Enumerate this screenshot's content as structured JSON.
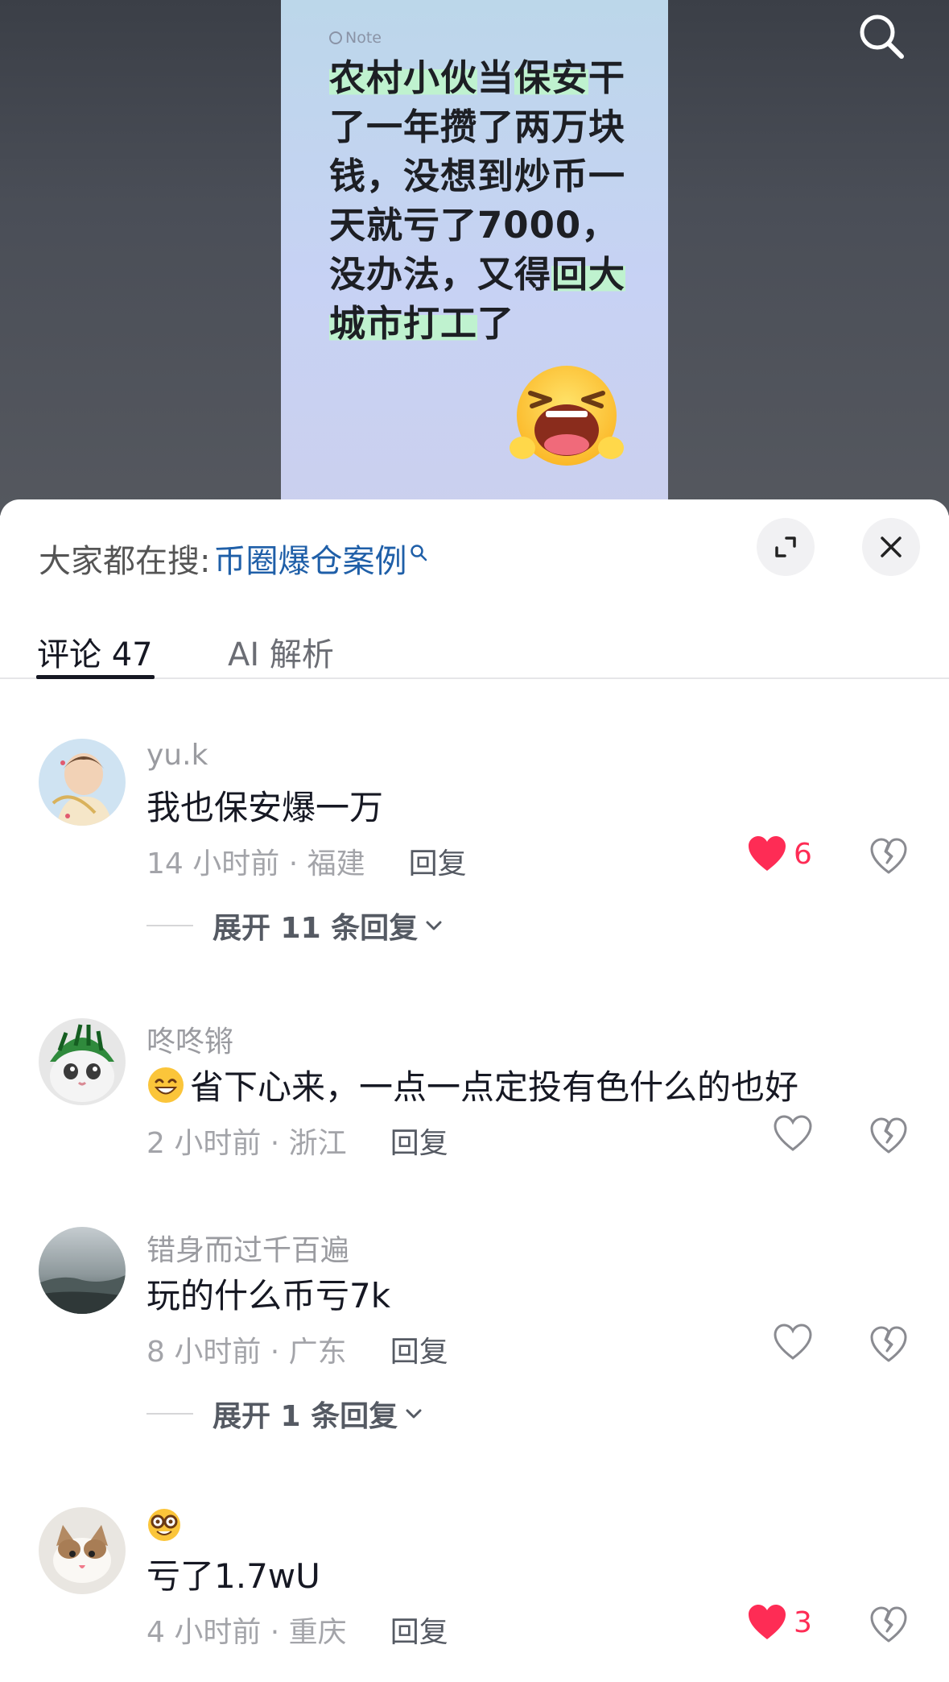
{
  "video": {
    "note_tag": "Note",
    "note_text_parts": [
      {
        "text": "农村小伙",
        "hl": true
      },
      {
        "text": "当",
        "hl": false
      },
      {
        "text": "保安",
        "hl": true
      },
      {
        "text": "干了一年攒了两万块钱，没想到炒币一天就亏了7000，没办法，又得",
        "hl": false
      },
      {
        "text": "回大城市打工",
        "hl": true
      },
      {
        "text": "了",
        "hl": false
      }
    ],
    "search_icon": "search-icon",
    "emoji": "crying-face-emoji"
  },
  "sheet": {
    "hot_search_label": "大家都在搜:",
    "hot_search_term": "币圈爆仓案例",
    "tabs": [
      {
        "label": "评论 47",
        "active": true
      },
      {
        "label": "AI 解析",
        "active": false
      }
    ]
  },
  "comments": [
    {
      "user": "yu.k",
      "text": "我也保安爆一万",
      "time_loc": "14 小时前 · 福建",
      "reply": "回复",
      "likes": "6",
      "liked": true,
      "expand": "展开 11 条回复"
    },
    {
      "user": "咚咚锵",
      "text": "省下心来，一点一点定投有色什么的也好",
      "time_loc": "2 小时前 · 浙江",
      "reply": "回复",
      "likes": "",
      "liked": false,
      "emoji": "grinning-face-emoji"
    },
    {
      "user": "错身而过千百遍",
      "text": "玩的什么币亏7k",
      "time_loc": "8 小时前 · 广东",
      "reply": "回复",
      "likes": "",
      "liked": false,
      "expand": "展开 1 条回复"
    },
    {
      "user_emoji": "nerd-face-emoji",
      "text": "亏了1.7wU",
      "time_loc": "4 小时前 · 重庆",
      "reply": "回复",
      "likes": "3",
      "liked": true
    }
  ],
  "colors": {
    "like_red": "#fe2c55",
    "link_blue": "#1f5fa8",
    "highlight_green": "#bff2cf"
  }
}
